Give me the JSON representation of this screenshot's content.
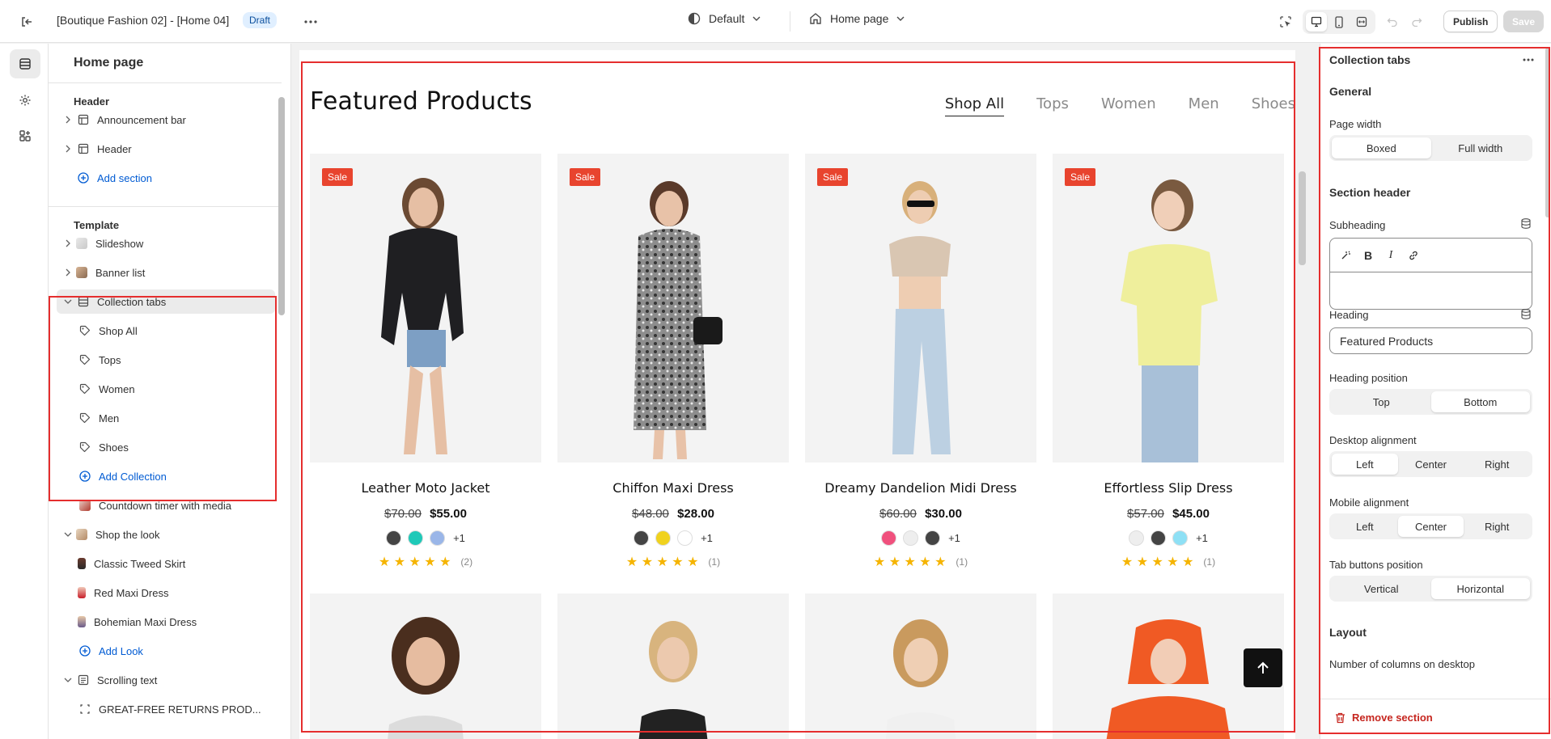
{
  "topbar": {
    "title": "[Boutique Fashion 02] - [Home 04]",
    "draft_badge": "Draft",
    "theme_label": "Default",
    "page_label": "Home page",
    "publish_label": "Publish",
    "save_label": "Save"
  },
  "sidebar": {
    "title": "Home page",
    "header_group": "Header",
    "header_items": [
      "Announcement bar",
      "Header"
    ],
    "add_section": "Add section",
    "template_group": "Template",
    "template_items": [
      "Slideshow",
      "Banner list",
      "Collection tabs"
    ],
    "collection_blocks": [
      "Shop All",
      "Tops",
      "Women",
      "Men",
      "Shoes"
    ],
    "add_collection": "Add Collection",
    "countdown": "Countdown timer with media",
    "shop_the_look": "Shop the look",
    "look_items": [
      "Classic Tweed Skirt",
      "Red Maxi Dress",
      "Bohemian Maxi Dress"
    ],
    "add_look": "Add Look",
    "scrolling_text": "Scrolling text",
    "scrolling_child": "GREAT-FREE RETURNS PROD..."
  },
  "preview": {
    "heading": "Featured Products",
    "tabs": [
      "Shop All",
      "Tops",
      "Women",
      "Men",
      "Shoes"
    ],
    "active_tab": "Shop All",
    "sale_label": "Sale",
    "products": [
      {
        "name": "Leather Moto Jacket",
        "old_price": "$70.00",
        "price": "$55.00",
        "swatches": [
          "#444444",
          "#1fc9b8",
          "#9ab6e8"
        ],
        "more": "+1",
        "reviews": "(2)",
        "stars": "★ ★ ★ ★ ★"
      },
      {
        "name": "Chiffon Maxi Dress",
        "old_price": "$48.00",
        "price": "$28.00",
        "swatches": [
          "#444444",
          "#f0d21e",
          "#ffffff"
        ],
        "more": "+1",
        "reviews": "(1)",
        "stars": "★ ★ ★ ★ ★"
      },
      {
        "name": "Dreamy Dandelion Midi Dress",
        "old_price": "$60.00",
        "price": "$30.00",
        "swatches": [
          "#f0507d",
          "#eeeeee",
          "#444444"
        ],
        "more": "+1",
        "reviews": "(1)",
        "stars": "★ ★ ★ ★ ★"
      },
      {
        "name": "Effortless Slip Dress",
        "old_price": "$57.00",
        "price": "$45.00",
        "swatches": [
          "#eeeeee",
          "#444444",
          "#8ee0f5"
        ],
        "more": "+1",
        "reviews": "(1)",
        "stars": "★ ★ ★ ★ ★"
      }
    ]
  },
  "settings": {
    "title": "Collection tabs",
    "general": "General",
    "page_width_label": "Page width",
    "page_width_options": [
      "Boxed",
      "Full width"
    ],
    "section_header": "Section header",
    "subheading_label": "Subheading",
    "heading_label": "Heading",
    "heading_value": "Featured Products",
    "heading_position_label": "Heading position",
    "heading_position_options": [
      "Top",
      "Bottom"
    ],
    "desktop_alignment_label": "Desktop alignment",
    "desktop_alignment_options": [
      "Left",
      "Center",
      "Right"
    ],
    "mobile_alignment_label": "Mobile alignment",
    "mobile_alignment_options": [
      "Left",
      "Center",
      "Right"
    ],
    "tab_buttons_label": "Tab buttons position",
    "tab_buttons_options": [
      "Vertical",
      "Horizontal"
    ],
    "layout": "Layout",
    "columns_label": "Number of columns on desktop",
    "remove_label": "Remove section"
  },
  "colors": {
    "accent_blue": "#005bd3",
    "sale_red": "#e8442e",
    "highlight_red": "#e52e2e",
    "star_yellow": "#f5b400"
  },
  "icons": [
    "exit-icon",
    "more-icon",
    "theme-icon",
    "home-icon",
    "chevron-down-icon",
    "inspector-icon",
    "desktop-icon",
    "mobile-icon",
    "fullscreen-icon",
    "undo-icon",
    "redo-icon",
    "sections-icon",
    "settings-icon",
    "apps-icon",
    "tag-icon",
    "plus-circle-icon",
    "database-icon",
    "trash-icon",
    "arrow-up-icon"
  ]
}
